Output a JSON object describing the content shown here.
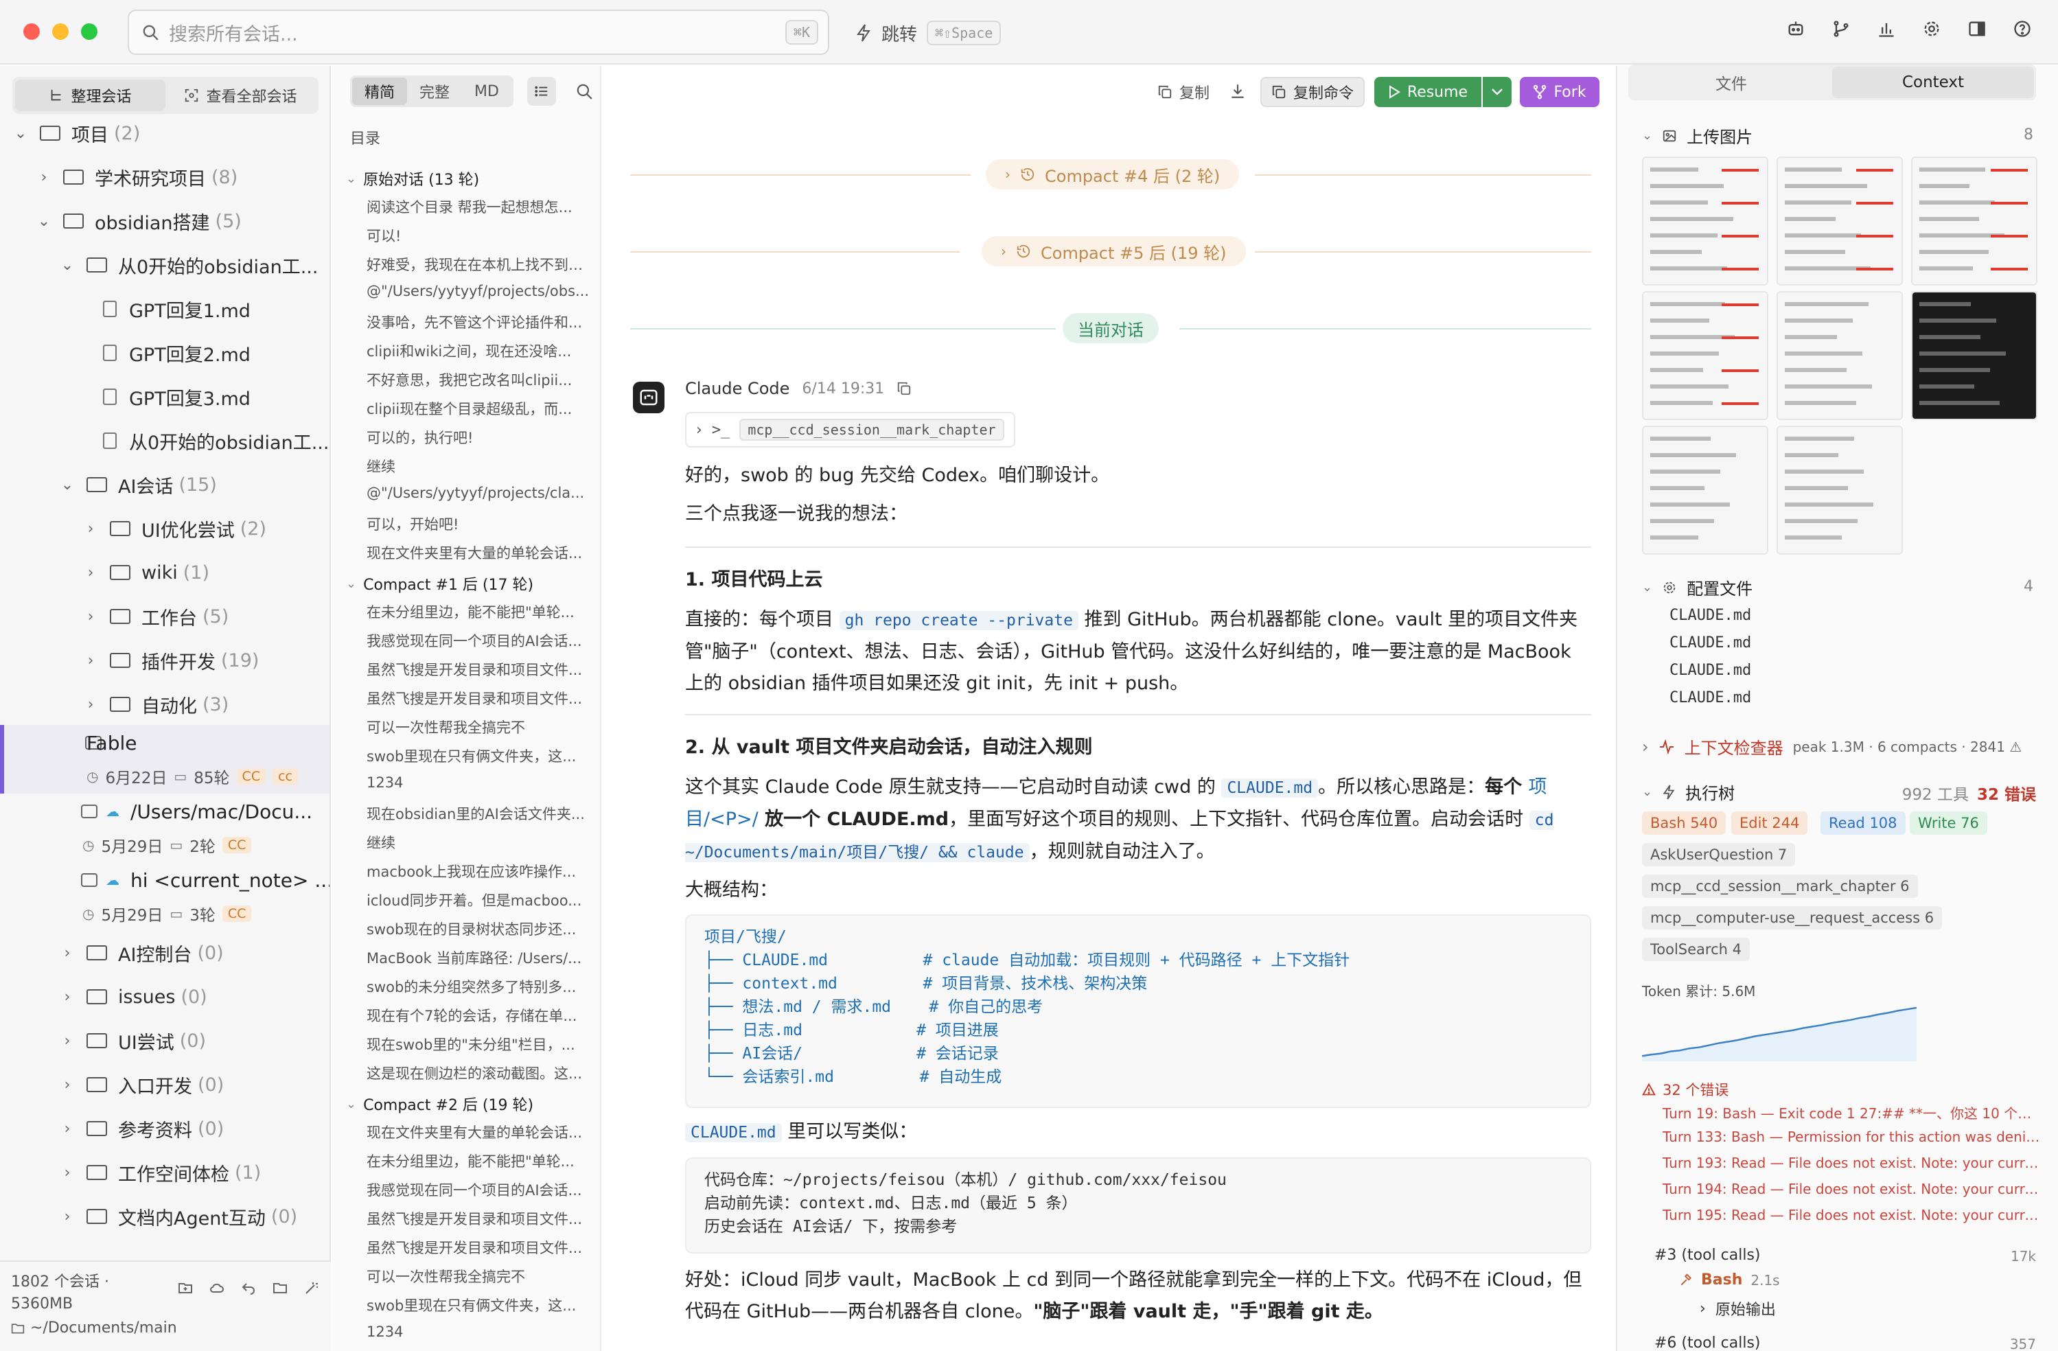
{
  "search": {
    "placeholder": "搜索所有会话...",
    "shortcut": "⌘K"
  },
  "jump": {
    "label": "跳转",
    "shortcut": "⌘⇧Space"
  },
  "sidebar": {
    "tabs": [
      "整理会话",
      "查看全部会话"
    ],
    "tree": [
      {
        "label": "项目",
        "count": "(2)",
        "level": 0,
        "expanded": true,
        "kind": "folder"
      },
      {
        "label": "学术研究项目",
        "count": "(8)",
        "level": 1,
        "expanded": false,
        "kind": "folder"
      },
      {
        "label": "obsidian搭建",
        "count": "(5)",
        "level": 1,
        "expanded": true,
        "kind": "folder"
      },
      {
        "label": "从0开始的obsidian工...",
        "count": "",
        "level": 2,
        "expanded": true,
        "kind": "folder"
      },
      {
        "label": "GPT回复1.md",
        "count": "",
        "level": 3,
        "kind": "doc"
      },
      {
        "label": "GPT回复2.md",
        "count": "",
        "level": 3,
        "kind": "doc"
      },
      {
        "label": "GPT回复3.md",
        "count": "",
        "level": 3,
        "kind": "doc"
      },
      {
        "label": "从0开始的obsidian工...",
        "count": "",
        "level": 3,
        "kind": "doc"
      },
      {
        "label": "AI会话",
        "count": "(15)",
        "level": 2,
        "expanded": true,
        "kind": "folder"
      },
      {
        "label": "UI优化尝试",
        "count": "(2)",
        "level": 3,
        "expanded": false,
        "kind": "folder"
      },
      {
        "label": "wiki",
        "count": "(1)",
        "level": 3,
        "expanded": false,
        "kind": "folder"
      },
      {
        "label": "工作台",
        "count": "(5)",
        "level": 3,
        "expanded": false,
        "kind": "folder"
      },
      {
        "label": "插件开发",
        "count": "(19)",
        "level": 3,
        "expanded": false,
        "kind": "folder"
      },
      {
        "label": "自动化",
        "count": "(3)",
        "level": 3,
        "expanded": false,
        "kind": "folder"
      }
    ],
    "sessions": [
      {
        "title": "Fable",
        "date": "6月22日",
        "turns": "85轮",
        "badge": "CC",
        "badge2": "cc",
        "selected": true
      },
      {
        "title": "/Users/mac/Docu...",
        "date": "5月29日",
        "turns": "2轮",
        "badge": "CC"
      },
      {
        "title": "hi <current_note> ...",
        "date": "5月29日",
        "turns": "3轮",
        "badge": "CC"
      }
    ],
    "tree2": [
      {
        "label": "AI控制台",
        "count": "(0)"
      },
      {
        "label": "issues",
        "count": "(0)"
      },
      {
        "label": "UI尝试",
        "count": "(0)"
      },
      {
        "label": "入口开发",
        "count": "(0)"
      },
      {
        "label": "参考资料",
        "count": "(0)"
      },
      {
        "label": "工作空间体检",
        "count": "(1)"
      },
      {
        "label": "文档内Agent互动",
        "count": "(0)"
      }
    ],
    "footer": {
      "count": "1802 个会话 ·",
      "size": "5360MB",
      "path": "~/Documents/main"
    }
  },
  "toc": {
    "view_tabs": [
      "精简",
      "完整",
      "MD"
    ],
    "heading": "目录",
    "sections": [
      {
        "title": "原始对话 (13 轮)",
        "items": [
          "阅读这个目录 帮我一起想想怎...",
          "可以!",
          "好难受，我现在在本机上找不到开...",
          "@\"/Users/yytyyf/projects/obs...",
          "没事哈，先不管这个评论插件和...",
          "clipii和wiki之间，现在还没啥...",
          "不好意思，我把它改名叫clipii...",
          "clipii现在整个目录超级乱，而...",
          "可以的，执行吧!",
          "继续",
          "@\"/Users/yytyyf/projects/cla...",
          "可以，开始吧!",
          "现在文件夹里有大量的单轮会话..."
        ]
      },
      {
        "title": "Compact #1 后 (17 轮)",
        "items": [
          "在未分组里边，能不能把\"单轮...",
          "我感觉现在同一个项目的AI会话...",
          "虽然飞搜是开发目录和项目文件...",
          "虽然飞搜是开发目录和项目文件...",
          "可以一次性帮我全搞完不",
          "swob里现在只有俩文件夹，这...",
          "1234",
          "现在obsidian里的AI会话文件夹...",
          "继续",
          "macbook上我现在应该咋操作...",
          "icloud同步开着。但是macboo...",
          "swob现在的目录树状态同步还...",
          "MacBook 当前库路径: /Users/...",
          "swob的未分组突然多了特别多...",
          "现在有个7轮的会话，存储在单...",
          "现在swob里的\"未分组\"栏目，...",
          "这是现在侧边栏的滚动截图。这..."
        ]
      },
      {
        "title": "Compact #2 后 (19 轮)",
        "items": [
          "现在文件夹里有大量的单轮会话...",
          "在未分组里边，能不能把\"单轮...",
          "我感觉现在同一个项目的AI会话...",
          "虽然飞搜是开发目录和项目文件...",
          "虽然飞搜是开发目录和项目文件...",
          "可以一次性帮我全搞完不",
          "swob里现在只有俩文件夹，这...",
          "1234"
        ]
      }
    ]
  },
  "toolbar": {
    "copy": "复制",
    "copy_cmd": "复制命令",
    "resume": "Resume",
    "fork": "Fork"
  },
  "conversation": {
    "compact4": "Compact #4 后 (2 轮)",
    "compact5": "Compact #5 后 (19 轮)",
    "current": "当前对话",
    "sender": "Claude Code",
    "time": "6/14 19:31",
    "tool": "mcp__ccd_session__mark_chapter",
    "p1": "好的，swob 的 bug 先交给 Codex。咱们聊设计。",
    "p2": "三个点我逐一说我的想法：",
    "h1": "1. 项目代码上云",
    "s1a": "直接的：每个项目 ",
    "s1code": "gh repo create --private",
    "s1b": " 推到 GitHub。两台机器都能 clone。vault 里的项目文件夹管\"脑子\"（context、想法、日志、会话），GitHub 管代码。这没什么好纠结的，唯一要注意的是 MacBook 上的 obsidian 插件项目如果还没 git init，先 init + push。",
    "h2": "2. 从 vault 项目文件夹启动会话，自动注入规则",
    "s2a": "这个其实 Claude Code 原生就支持——它启动时自动读 cwd 的 ",
    "s2code1": "CLAUDE.md",
    "s2b": "。所以核心思路是：",
    "s2bold1": "每个 ",
    "s2link": "项目/<P>/",
    "s2bold2": " 放一个 CLAUDE.md",
    "s2c": "，里面写好这个项目的规则、上下文指针、代码仓库位置。启动会话时 ",
    "s2code2": "cd ~/Documents/main/项目/飞搜/ && claude",
    "s2d": "，规则就自动注入了。",
    "struct_label": "大概结构：",
    "tree_lines": [
      {
        "name": "项目/飞搜/",
        "comment": ""
      },
      {
        "name": "├── CLAUDE.md          ",
        "comment": "# claude 自动加载：项目规则 + 代码路径 + 上下文指针"
      },
      {
        "name": "├── context.md         ",
        "comment": "# 项目背景、技术栈、架构决策"
      },
      {
        "name": "├── 想法.md / 需求.md    ",
        "comment": "# 你自己的思考"
      },
      {
        "name": "├── 日志.md            ",
        "comment": "# 项目进展"
      },
      {
        "name": "├── AI会话/            ",
        "comment": "# 会话记录"
      },
      {
        "name": "└── 会话索引.md         ",
        "comment": "# 自动生成"
      }
    ],
    "claude_md_label_code": "CLAUDE.md",
    "claude_md_label": " 里可以写类似：",
    "code2_lines": [
      "代码仓库：~/projects/feisou（本机）/ github.com/xxx/feisou",
      "启动前先读：context.md、日志.md（最近 5 条）",
      "历史会话在 AI会话/ 下，按需参考"
    ],
    "last_a": "好处：iCloud 同步 vault，MacBook 上 cd 到同一个路径就能拿到完全一样的上下文。代码不在 iCloud，但代码在 GitHub——两台机器各自 clone。",
    "last_bold": "\"脑子\"跟着 vault 走，\"手\"跟着 git 走。"
  },
  "right": {
    "tabs": [
      "文件",
      "Context"
    ],
    "images": {
      "title": "上传图片",
      "count": "8"
    },
    "config": {
      "title": "配置文件",
      "count": "4",
      "files": [
        "CLAUDE.md",
        "CLAUDE.md",
        "CLAUDE.md",
        "CLAUDE.md"
      ]
    },
    "inspector": {
      "title": "上下文检查器",
      "meta": "peak 1.3M · 6 compacts · 2841 ⚠"
    },
    "exec": {
      "title": "执行树",
      "tools": "992 工具",
      "errors": "32 错误"
    },
    "tags": [
      {
        "label": "Bash 540",
        "color": "#c25b2e",
        "bg": "#fbe6da"
      },
      {
        "label": "Edit 244",
        "color": "#c25b2e",
        "bg": "#fbe6da"
      },
      {
        "label": "Read 108",
        "color": "#2e6fc2",
        "bg": "#e1ecfa"
      },
      {
        "label": "Write 76",
        "color": "#2f8a4e",
        "bg": "#e2f3e7"
      },
      {
        "label": "AskUserQuestion 7",
        "color": "#555",
        "bg": "#ededed"
      },
      {
        "label": "mcp__ccd_session__mark_chapter 6",
        "color": "#555",
        "bg": "#ededed"
      },
      {
        "label": "mcp__computer-use__request_access 6",
        "color": "#555",
        "bg": "#ededed"
      },
      {
        "label": "ToolSearch 4",
        "color": "#555",
        "bg": "#ededed"
      }
    ],
    "token": "Token 累计: 5.6M",
    "spark": [
      0.05,
      0.08,
      0.1,
      0.14,
      0.16,
      0.2,
      0.22,
      0.26,
      0.3,
      0.33,
      0.36,
      0.4,
      0.44,
      0.47,
      0.5,
      0.53,
      0.56,
      0.6,
      0.63,
      0.66,
      0.7,
      0.73,
      0.76,
      0.8,
      0.83,
      0.87,
      0.9,
      0.94,
      0.97,
      1.0
    ],
    "errors_title": "32 个错误",
    "errors": [
      "Turn 19: Bash — Exit code 1 27:## **一、你这 10 个目标...",
      "Turn 133: Bash — Permission for this action was denie...",
      "Turn 193: Read — File does not exist. Note: your curre...",
      "Turn 194: Read — File does not exist. Note: your curre...",
      "Turn 195: Read — File does not exist. Note: your curre..."
    ],
    "call3": {
      "label": "#3 (tool calls)",
      "size": "17k",
      "tool": "Bash",
      "dur": "2.1s",
      "raw": "原始输出"
    },
    "call6": {
      "label": "#6 (tool calls)",
      "size": "357"
    }
  },
  "colors": {
    "accent": "#7c5cd6",
    "resume": "#3f9b56",
    "fork": "#a45bdc",
    "pill": "#c08a4c"
  }
}
